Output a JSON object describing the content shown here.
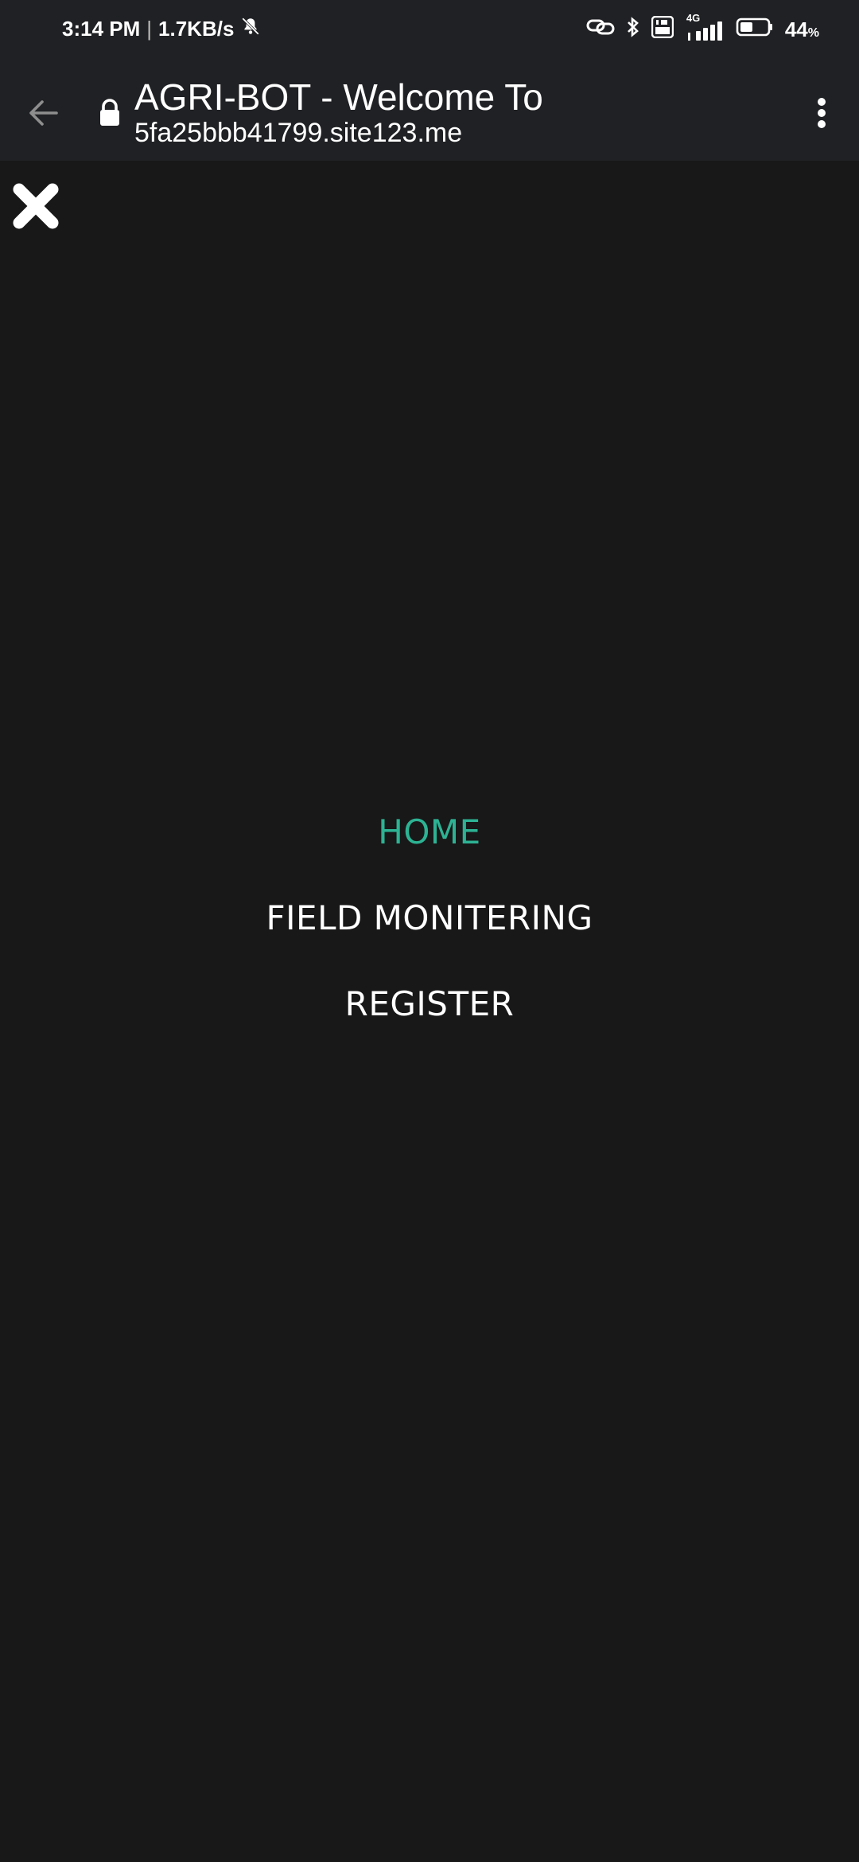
{
  "status_bar": {
    "time": "3:14 PM",
    "separator": "|",
    "speed": "1.7KB/s",
    "network": "4G",
    "battery_percent": "44",
    "battery_unit": "%",
    "battery_level": 0.44,
    "icons": [
      "mute-bell-icon",
      "link-icon",
      "bluetooth-icon",
      "volte-icon",
      "signal-icon",
      "battery-icon"
    ]
  },
  "browser": {
    "page_title": "AGRI-BOT - Welcome To",
    "host": "5fa25bbb41799.site123.me"
  },
  "menu": {
    "items": [
      {
        "label": "HOME",
        "active": true
      },
      {
        "label": "FIELD MONITERING",
        "active": false
      },
      {
        "label": "REGISTER",
        "active": false
      }
    ],
    "active_color": "#2db394"
  },
  "colors": {
    "background": "#181818",
    "toolbar": "#202124"
  }
}
